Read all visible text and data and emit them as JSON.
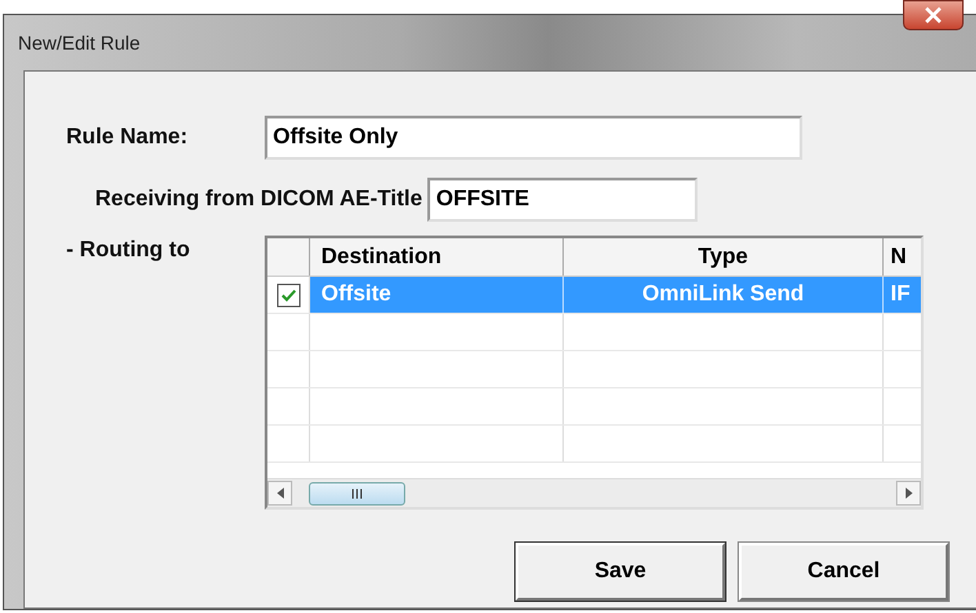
{
  "window": {
    "title": "New/Edit Rule"
  },
  "rule_name": {
    "label": "Rule Name:",
    "value": "Offsite Only"
  },
  "receiving": {
    "label": "Receiving from DICOM AE-Title",
    "value": "OFFSITE"
  },
  "routing": {
    "label": "- Routing to",
    "table": {
      "columns": [
        "Destination",
        "Type",
        "N"
      ],
      "rows": [
        {
          "checked": true,
          "selected": true,
          "cells": [
            "Offsite",
            "OmniLink Send",
            "IF"
          ]
        }
      ]
    }
  },
  "buttons": [
    "Save",
    "Cancel"
  ]
}
